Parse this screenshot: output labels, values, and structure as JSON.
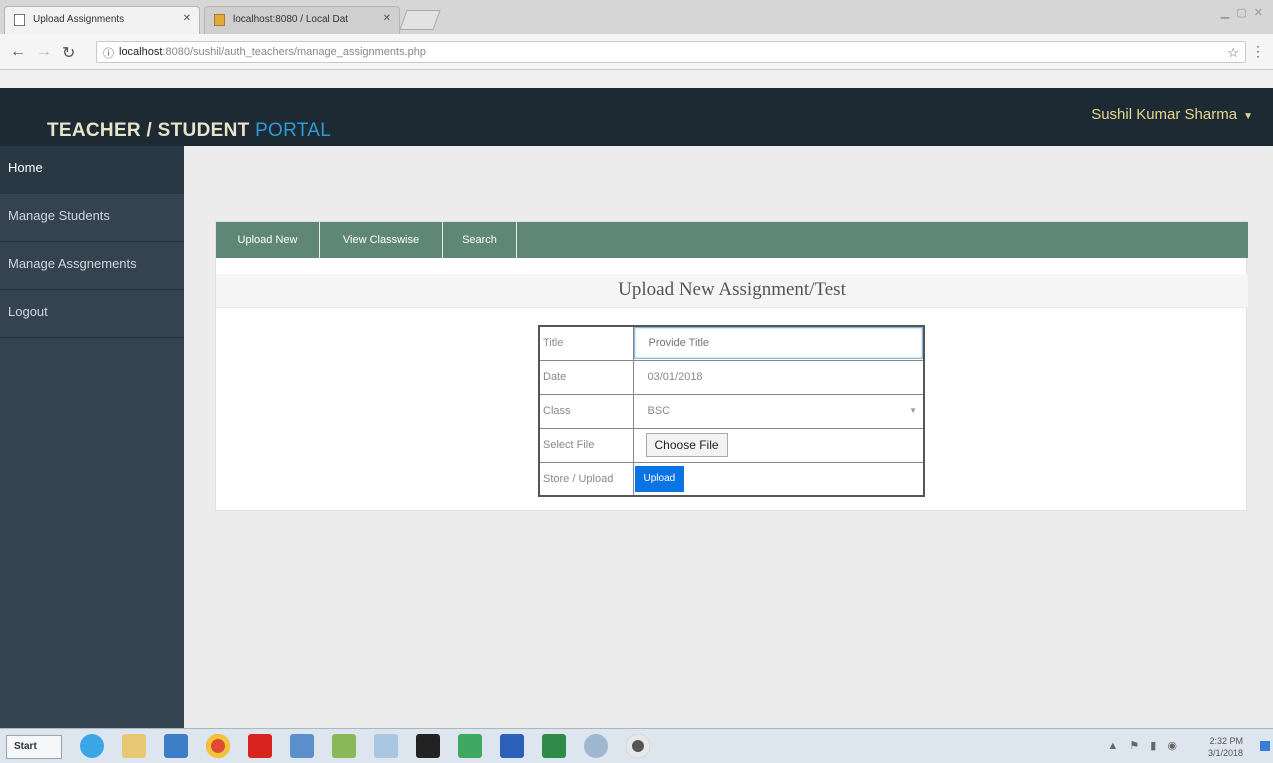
{
  "browser": {
    "tabs": [
      {
        "label": "Upload Assignments"
      },
      {
        "label": "localhost:8080 / Local Dat"
      }
    ],
    "url_host": "localhost",
    "url_path": ":8080/sushil/auth_teachers/manage_assignments.php"
  },
  "header": {
    "brand_main": "TEACHER / STUDENT ",
    "brand_accent": "PORTAL",
    "user_name": "Sushil Kumar Sharma"
  },
  "sidebar": {
    "items": [
      {
        "label": "Home"
      },
      {
        "label": "Manage Students"
      },
      {
        "label": "Manage Assgnements"
      },
      {
        "label": "Logout"
      }
    ]
  },
  "tabs": [
    {
      "label": "Upload New"
    },
    {
      "label": "View Classwise"
    },
    {
      "label": "Search"
    }
  ],
  "form": {
    "title": "Upload New Assignment/Test",
    "rows": {
      "title_label": "Title",
      "title_placeholder": "Provide Title",
      "date_label": "Date",
      "date_value": "03/01/2018",
      "class_label": "Class",
      "class_value": "BSC",
      "file_label": "Select File",
      "file_button": "Choose File",
      "store_label": "Store / Upload",
      "upload_button": "Upload"
    }
  },
  "taskbar": {
    "start_label": "Start",
    "time": "2:32 PM",
    "date": "3/1/2018"
  }
}
